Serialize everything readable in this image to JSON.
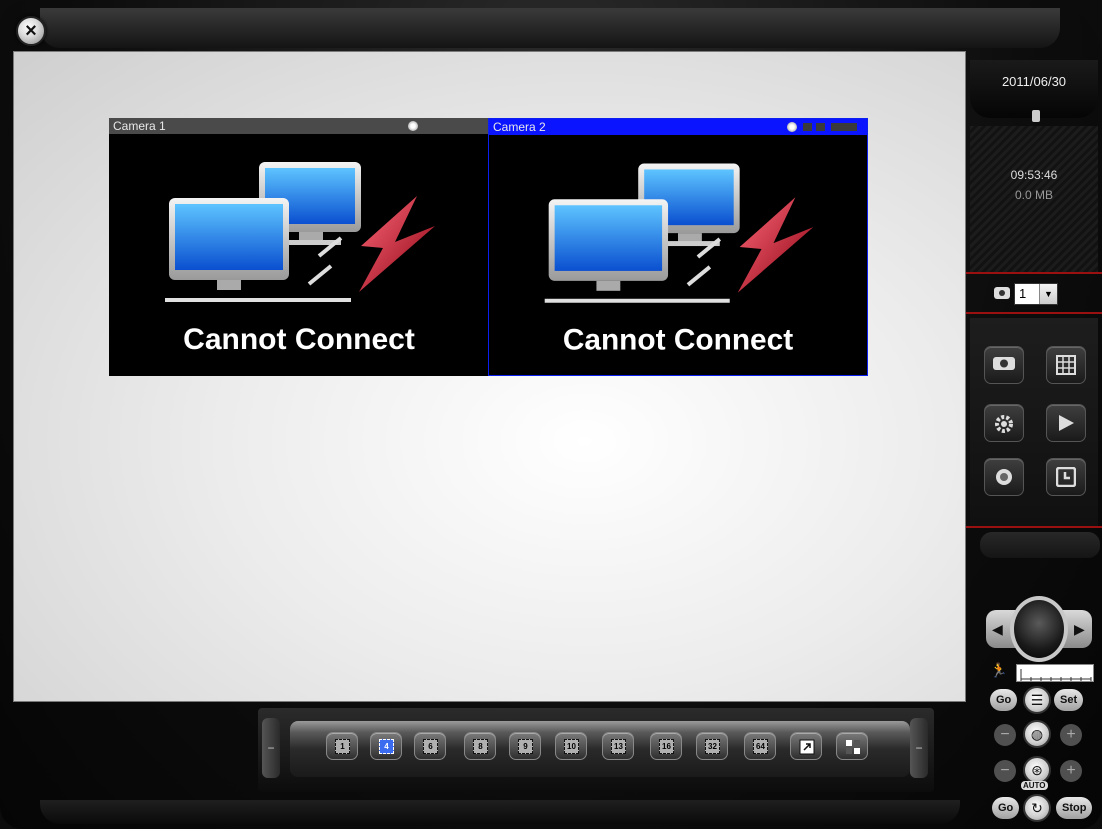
{
  "window": {
    "close_label": "×"
  },
  "cameras": [
    {
      "title": "Camera 1",
      "status": "Cannot Connect"
    },
    {
      "title": "Camera 2",
      "status": "Cannot Connect"
    }
  ],
  "sidebar": {
    "date": "2011/06/30",
    "time": "09:53:46",
    "storage": "0.0 MB",
    "camera_select_value": "1",
    "ptz": {
      "go_label": "Go",
      "set_label": "Set",
      "go2_label": "Go",
      "stop_label": "Stop",
      "auto_label": "AUTO",
      "minus_label": "−",
      "plus_label": "+"
    }
  },
  "toolbar": {
    "layouts": [
      "1",
      "4",
      "6",
      "8",
      "9",
      "10",
      "13",
      "16",
      "32",
      "64"
    ],
    "active_layout": "4"
  },
  "colors": {
    "active_camera_header": "#0a14ff",
    "inactive_camera_header": "#4a4a4a",
    "sidebar_redline": "#9a1010"
  }
}
